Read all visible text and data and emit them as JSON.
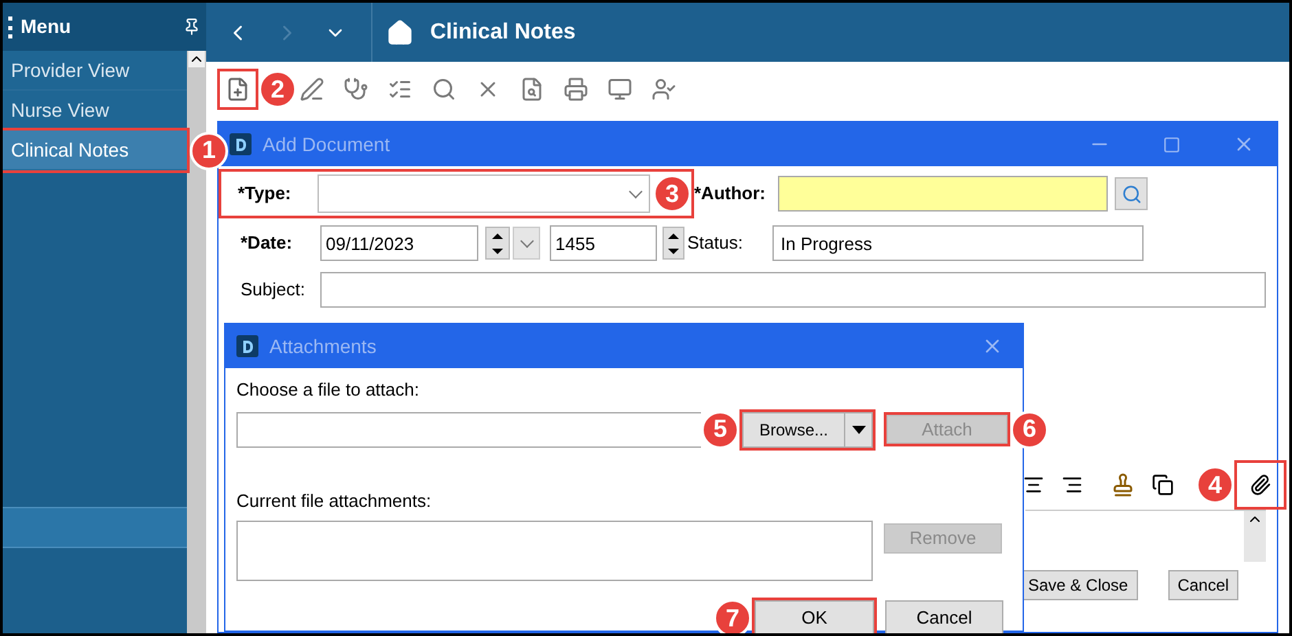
{
  "menu": {
    "title": "Menu",
    "items": [
      {
        "label": "Provider View",
        "selected": false
      },
      {
        "label": "Nurse View",
        "selected": false
      },
      {
        "label": "Clinical Notes",
        "selected": true,
        "callout": "1"
      }
    ]
  },
  "header": {
    "title": "Clinical Notes"
  },
  "toolbar": {
    "new_button": {
      "callout": "2"
    }
  },
  "add_document": {
    "title": "Add Document",
    "type": {
      "label": "*Type:",
      "callout": "3"
    },
    "author": {
      "label": "*Author:"
    },
    "date": {
      "label": "*Date:",
      "value": "09/11/2023",
      "time": "1455"
    },
    "status": {
      "label": "Status:",
      "value": "In Progress"
    },
    "subject": {
      "label": "Subject:"
    },
    "editor_toolbar": {
      "attach_button": {
        "callout": "4"
      }
    },
    "buttons": [
      {
        "label": "Save & Close"
      },
      {
        "label": "Cancel"
      }
    ]
  },
  "attachments": {
    "title": "Attachments",
    "choose_label": "Choose a file to attach:",
    "browse": {
      "label": "Browse...",
      "callout": "5"
    },
    "attach": {
      "label": "Attach",
      "disabled": true,
      "callout": "6"
    },
    "current_label": "Current file attachments:",
    "remove": {
      "label": "Remove",
      "disabled": true
    },
    "ok": {
      "label": "OK",
      "disabled": false,
      "callout": "7"
    },
    "cancel": {
      "label": "Cancel",
      "disabled": false
    }
  }
}
